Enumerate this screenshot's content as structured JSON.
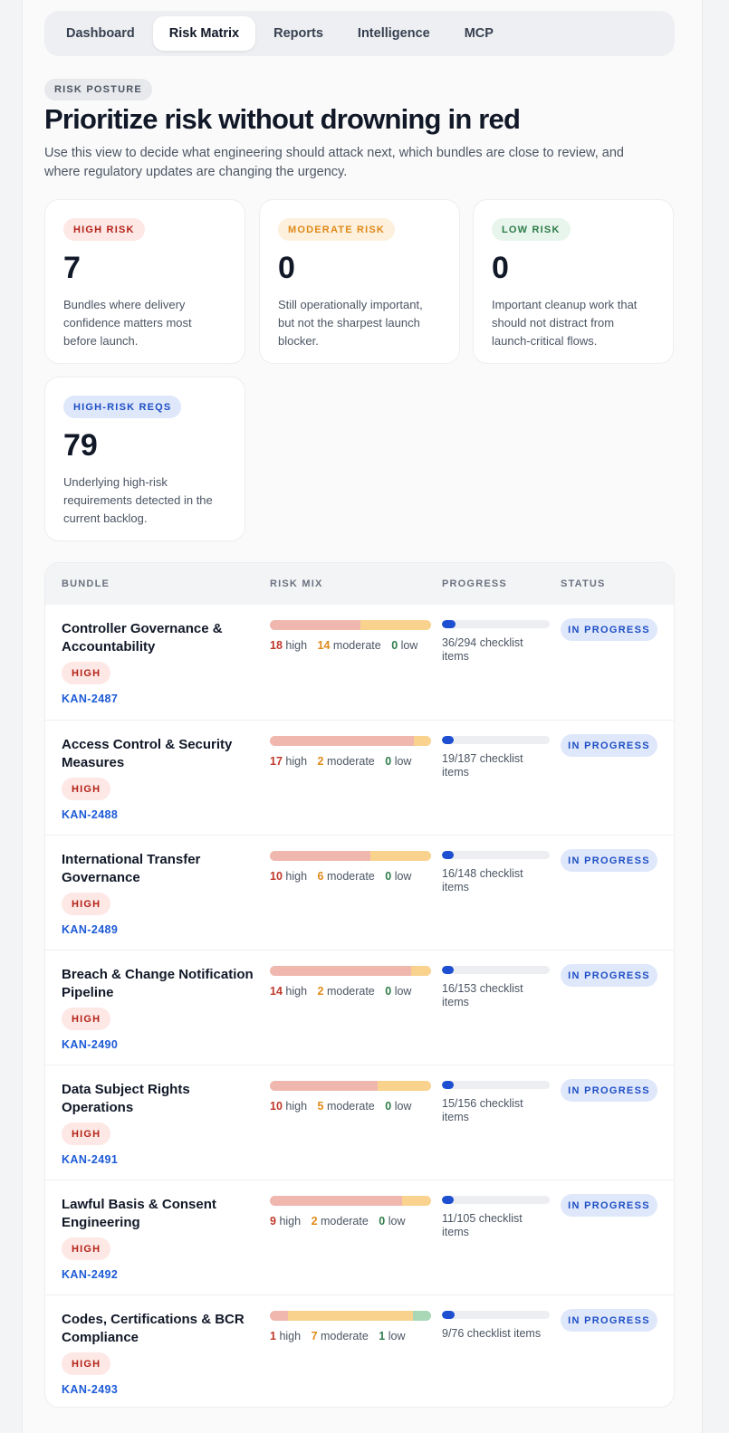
{
  "tabs": [
    {
      "label": "Dashboard",
      "active": false
    },
    {
      "label": "Risk Matrix",
      "active": true
    },
    {
      "label": "Reports",
      "active": false
    },
    {
      "label": "Intelligence",
      "active": false
    },
    {
      "label": "MCP",
      "active": false
    }
  ],
  "header": {
    "eyebrow": "RISK POSTURE",
    "title": "Prioritize risk without drowning in red",
    "subtitle": "Use this view to decide what engineering should attack next, which bundles are close to review, and where regulatory updates are changing the urgency."
  },
  "summary_cards": [
    {
      "label": "HIGH RISK",
      "value": "7",
      "description": "Bundles where delivery confidence matters most before launch.",
      "tone": "red"
    },
    {
      "label": "MODERATE RISK",
      "value": "0",
      "description": "Still operationally important, but not the sharpest launch blocker.",
      "tone": "orange"
    },
    {
      "label": "LOW RISK",
      "value": "0",
      "description": "Important cleanup work that should not distract from launch-critical flows.",
      "tone": "green"
    },
    {
      "label": "HIGH-RISK REQS",
      "value": "79",
      "description": "Underlying high-risk requirements detected in the current backlog.",
      "tone": "blue"
    }
  ],
  "table": {
    "columns": [
      "BUNDLE",
      "RISK MIX",
      "PROGRESS",
      "STATUS"
    ],
    "labels": {
      "high": "high",
      "moderate": "moderate",
      "low": "low"
    },
    "rows": [
      {
        "name": "Controller Governance & Accountability",
        "risk": "HIGH",
        "key": "KAN-2487",
        "high": 18,
        "moderate": 14,
        "low": 0,
        "done": 36,
        "total": 294,
        "progress_text": "36/294 checklist items",
        "status": "IN PROGRESS"
      },
      {
        "name": "Access Control & Security Measures",
        "risk": "HIGH",
        "key": "KAN-2488",
        "high": 17,
        "moderate": 2,
        "low": 0,
        "done": 19,
        "total": 187,
        "progress_text": "19/187 checklist items",
        "status": "IN PROGRESS"
      },
      {
        "name": "International Transfer Governance",
        "risk": "HIGH",
        "key": "KAN-2489",
        "high": 10,
        "moderate": 6,
        "low": 0,
        "done": 16,
        "total": 148,
        "progress_text": "16/148 checklist items",
        "status": "IN PROGRESS"
      },
      {
        "name": "Breach & Change Notification Pipeline",
        "risk": "HIGH",
        "key": "KAN-2490",
        "high": 14,
        "moderate": 2,
        "low": 0,
        "done": 16,
        "total": 153,
        "progress_text": "16/153 checklist items",
        "status": "IN PROGRESS"
      },
      {
        "name": "Data Subject Rights Operations",
        "risk": "HIGH",
        "key": "KAN-2491",
        "high": 10,
        "moderate": 5,
        "low": 0,
        "done": 15,
        "total": 156,
        "progress_text": "15/156 checklist items",
        "status": "IN PROGRESS"
      },
      {
        "name": "Lawful Basis & Consent Engineering",
        "risk": "HIGH",
        "key": "KAN-2492",
        "high": 9,
        "moderate": 2,
        "low": 0,
        "done": 11,
        "total": 105,
        "progress_text": "11/105 checklist items",
        "status": "IN PROGRESS"
      },
      {
        "name": "Codes, Certifications & BCR Compliance",
        "risk": "HIGH",
        "key": "KAN-2493",
        "high": 1,
        "moderate": 7,
        "low": 1,
        "done": 9,
        "total": 76,
        "progress_text": "9/76 checklist items",
        "status": "IN PROGRESS"
      }
    ]
  }
}
